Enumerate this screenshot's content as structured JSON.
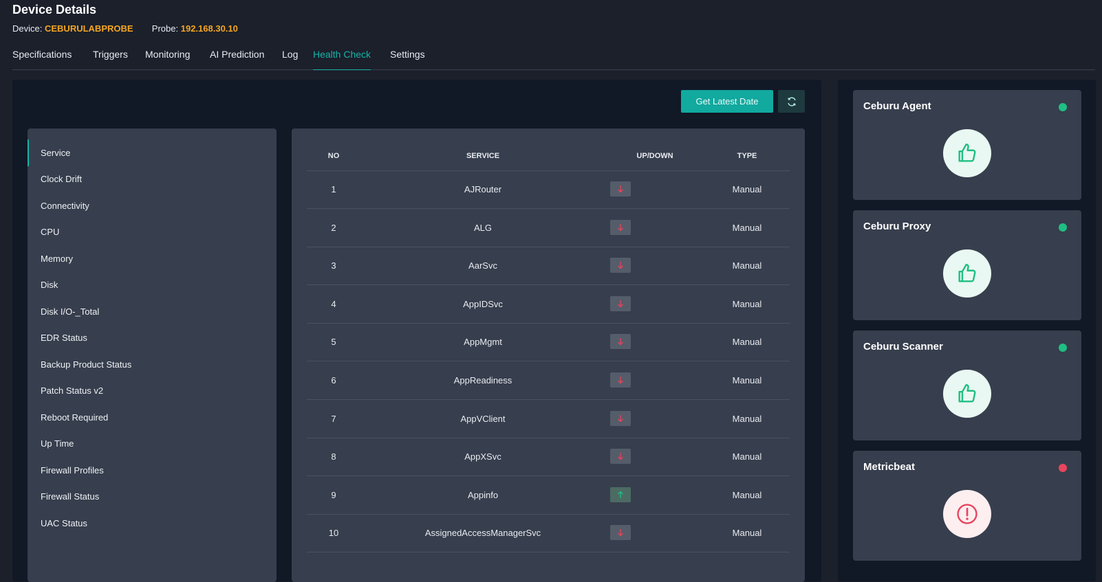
{
  "header": {
    "title": "Device Details",
    "device_label": "Device:",
    "device_value": "CEBURULABPROBE",
    "probe_label": "Probe:",
    "probe_value": "192.168.30.10"
  },
  "tabs": [
    {
      "label": "Specifications"
    },
    {
      "label": "Triggers"
    },
    {
      "label": "Monitoring"
    },
    {
      "label": "AI Prediction"
    },
    {
      "label": "Log"
    },
    {
      "label": "Health Check",
      "active": true
    },
    {
      "label": "Settings"
    }
  ],
  "toolbar": {
    "latest_label": "Get Latest Date",
    "refresh_icon": "refresh-icon"
  },
  "sidebar": {
    "items": [
      {
        "label": "Service",
        "active": true
      },
      {
        "label": "Clock Drift"
      },
      {
        "label": "Connectivity"
      },
      {
        "label": "CPU"
      },
      {
        "label": "Memory"
      },
      {
        "label": "Disk"
      },
      {
        "label": "Disk I/O-_Total"
      },
      {
        "label": "EDR Status"
      },
      {
        "label": "Backup Product Status"
      },
      {
        "label": "Patch Status v2"
      },
      {
        "label": "Reboot Required"
      },
      {
        "label": "Up Time"
      },
      {
        "label": "Firewall Profiles"
      },
      {
        "label": "Firewall Status"
      },
      {
        "label": "UAC Status"
      }
    ]
  },
  "table": {
    "columns": [
      "NO",
      "SERVICE",
      "UP/DOWN",
      "TYPE"
    ],
    "rows": [
      {
        "no": "1",
        "service": "AJRouter",
        "status": "down",
        "type": "Manual"
      },
      {
        "no": "2",
        "service": "ALG",
        "status": "down",
        "type": "Manual"
      },
      {
        "no": "3",
        "service": "AarSvc",
        "status": "down",
        "type": "Manual"
      },
      {
        "no": "4",
        "service": "AppIDSvc",
        "status": "down",
        "type": "Manual"
      },
      {
        "no": "5",
        "service": "AppMgmt",
        "status": "down",
        "type": "Manual"
      },
      {
        "no": "6",
        "service": "AppReadiness",
        "status": "down",
        "type": "Manual"
      },
      {
        "no": "7",
        "service": "AppVClient",
        "status": "down",
        "type": "Manual"
      },
      {
        "no": "8",
        "service": "AppXSvc",
        "status": "down",
        "type": "Manual"
      },
      {
        "no": "9",
        "service": "Appinfo",
        "status": "up",
        "type": "Manual"
      },
      {
        "no": "10",
        "service": "AssignedAccessManagerSvc",
        "status": "down",
        "type": "Manual"
      }
    ]
  },
  "status_cards": [
    {
      "title": "Ceburu Agent",
      "state": "ok",
      "icon": "thumbs-up-icon",
      "dot_color": "#1fbf83"
    },
    {
      "title": "Ceburu Proxy",
      "state": "ok",
      "icon": "thumbs-up-icon",
      "dot_color": "#1fbf83"
    },
    {
      "title": "Ceburu Scanner",
      "state": "ok",
      "icon": "thumbs-up-icon",
      "dot_color": "#1fbf83"
    },
    {
      "title": "Metricbeat",
      "state": "error",
      "icon": "alert-circle-icon",
      "dot_color": "#e8455e"
    }
  ],
  "colors": {
    "accent": "#17b3a8",
    "highlight": "#f5a623",
    "ok": "#1fbf83",
    "error": "#e8455e"
  }
}
